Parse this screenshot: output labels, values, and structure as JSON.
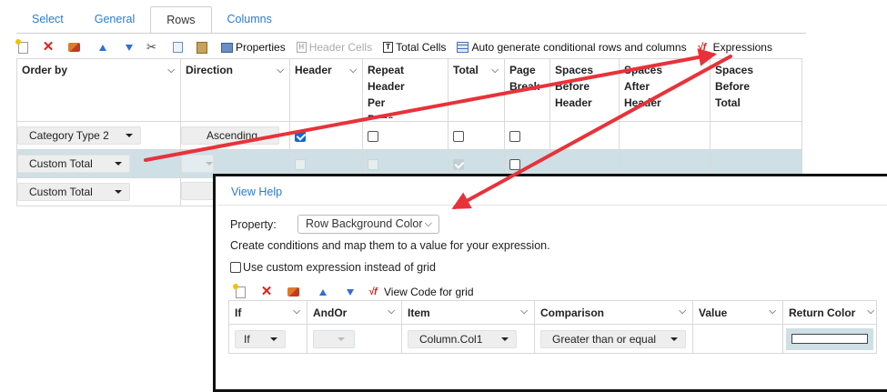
{
  "tabs": [
    {
      "label": "Select",
      "active": false
    },
    {
      "label": "General",
      "active": false
    },
    {
      "label": "Rows",
      "active": true
    },
    {
      "label": "Columns",
      "active": false
    }
  ],
  "toolbar": {
    "properties": "Properties",
    "header_cells": "Header Cells",
    "total_cells": "Total Cells",
    "auto_generate": "Auto generate conditional rows and columns",
    "expressions": "Expressions"
  },
  "grid": {
    "headers": {
      "order_by": "Order by",
      "direction": "Direction",
      "header": "Header",
      "repeat_header": "Repeat Header Per Page",
      "total": "Total",
      "page_break": "Page Break",
      "spaces_before_header": "Spaces Before Header",
      "spaces_after_header": "Spaces After Header",
      "spaces_before_total": "Spaces Before Total"
    },
    "rows": [
      {
        "order_by": "Category Type 2",
        "direction": "Ascending",
        "header": true,
        "repeat": false,
        "total": false,
        "page_break": false
      },
      {
        "order_by": "Custom Total",
        "direction": "",
        "header": false,
        "repeat": false,
        "total": true,
        "page_break": false,
        "selected": true
      },
      {
        "order_by": "Custom Total",
        "direction": "",
        "header": false,
        "repeat": false,
        "total": false,
        "page_break": false
      }
    ]
  },
  "popup": {
    "view_help": "View Help",
    "property_label": "Property:",
    "property_value": "Row Background Color",
    "description": "Create conditions and map them to a value for your expression.",
    "custom_expression_label": "Use custom expression instead of grid",
    "custom_expression_checked": false,
    "view_code": "View Code for grid",
    "columns": {
      "if": "If",
      "andor": "AndOr",
      "item": "Item",
      "comparison": "Comparison",
      "value": "Value",
      "return_color": "Return Color"
    },
    "row": {
      "if": "If",
      "andor": "",
      "item": "Column.Col1",
      "comparison": "Greater than or equal",
      "value": "",
      "return_color": "#ffffff"
    }
  },
  "colors": {
    "accent_link": "#2a7bd6",
    "selected_row": "#cfdfe6",
    "annotation_arrow": "#e8323a",
    "checkbox_checked": "#1565d8"
  }
}
